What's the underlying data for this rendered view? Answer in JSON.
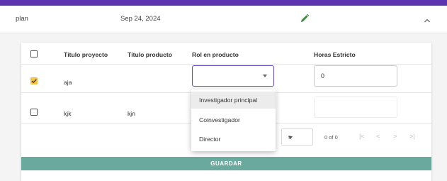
{
  "row": {
    "name": "plan",
    "date": "Sep 24, 2024",
    "edit_icon": "pencil-icon",
    "collapse_icon": "chevron-up-icon"
  },
  "table": {
    "headers": [
      "Título proyecto",
      "Título producto",
      "Rol en producto",
      "Horas Estricto"
    ],
    "rows": [
      {
        "checked": true,
        "titulo_proyecto": "aja",
        "titulo_producto": "",
        "rol": "",
        "horas": "0"
      },
      {
        "checked": false,
        "titulo_proyecto": "kjk",
        "titulo_producto": "kjn",
        "rol": "",
        "horas": ""
      }
    ]
  },
  "rol_dropdown": {
    "options": [
      "Investigador principal",
      "Coinvestigador",
      "Director"
    ],
    "highlighted": "Investigador principal"
  },
  "pagination": {
    "page_size": "5",
    "range_label": "0 of 0",
    "first_icon": "first-page-icon",
    "prev_icon": "chevron-left-icon",
    "next_icon": "chevron-right-icon",
    "last_icon": "last-page-icon"
  },
  "actions": {
    "save_label": "GUARDAR"
  },
  "colors": {
    "accent_bar": "#5e35b1",
    "checkbox_checked": "#f6c244",
    "select_focus": "#5b4ad8",
    "save_button": "#6aa99e"
  }
}
